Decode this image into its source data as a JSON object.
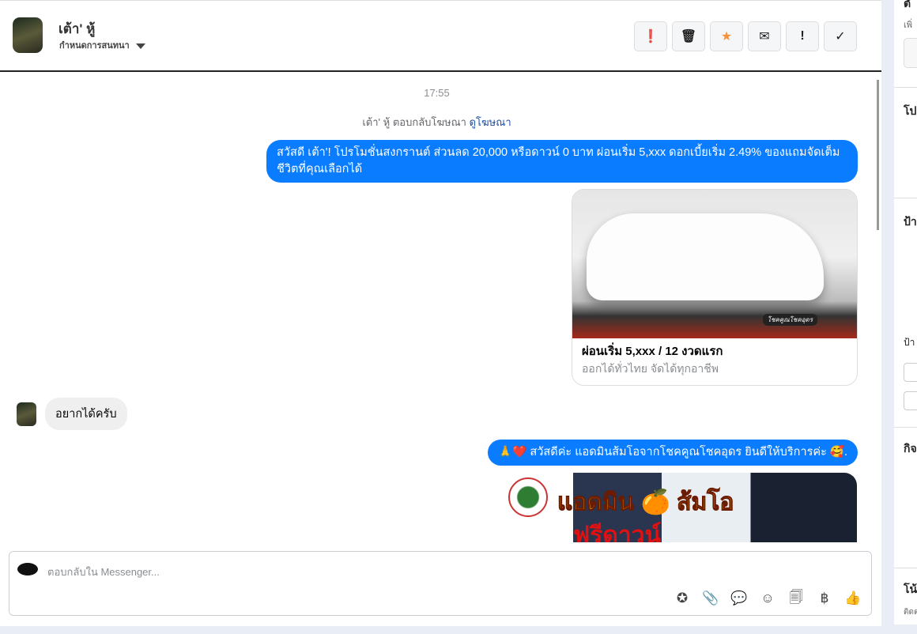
{
  "header": {
    "name": "เต้า' หู้",
    "assign_label": "กำหนดการสนทนา"
  },
  "actions": [
    {
      "name": "spam",
      "glyph": "❗"
    },
    {
      "name": "delete",
      "glyph": "🗑"
    },
    {
      "name": "star",
      "glyph": "★"
    },
    {
      "name": "mark-unread",
      "glyph": "✉"
    },
    {
      "name": "important",
      "glyph": "!"
    },
    {
      "name": "done",
      "glyph": "✓"
    }
  ],
  "thread": {
    "timestamp": "17:55",
    "ad_note": "เต้า' หู้ ตอบกลับโฆษณา",
    "ad_link": "ดูโฆษณา",
    "msg1": "สวัสดี เต้า'! โปรโมชั่นสงกรานต์ ส่วนลด 20,000 หรือดาวน์ 0 บาท ผ่อนเริ่ม 5,xxx ดอกเบี้ยเริ่ม 2.49% ของแถมจัดเต็ม ชีวิตที่คุณเลือกได้",
    "card_title": "ผ่อนเริ่ม 5,xxx / 12 งวดแรก",
    "card_sub": "ออกได้ทั่วไทย จัดได้ทุกอาชีพ",
    "card_image_caption": "โชคคูณโชคอุดร",
    "msg2": "อยากได้ครับ",
    "msg3": "🙏❤️ สวัสดีค่ะ แอดมินส้มโอจากโชคคูณโชคอุดร ยินดีให้บริการค่ะ 🥰.",
    "promo_line1": "แอดมิน 🍊 ส้มโอ",
    "promo_line2": "ฟรีดาวน์"
  },
  "composer": {
    "placeholder": "ตอบกลับใน Messenger...",
    "tools": [
      "✪",
      "📎",
      "💬",
      "☺",
      "🗐",
      "฿",
      "👍"
    ]
  },
  "right_panel": {
    "h1": "ตั",
    "sub1": "เพิ่",
    "h2": "โป",
    "h3": "ป้า",
    "sub3": "ป้า",
    "h4": "กิจ",
    "h5": "โน้",
    "sub5": "ติดต"
  }
}
